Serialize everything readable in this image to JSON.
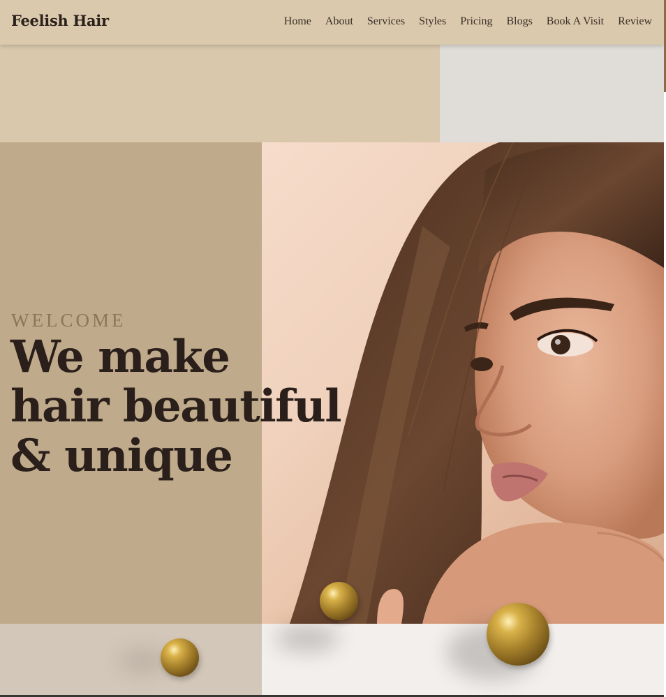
{
  "brand": "Feelish Hair",
  "nav": [
    "Home",
    "About",
    "Services",
    "Styles",
    "Pricing",
    "Blogs",
    "Book A Visit",
    "Review"
  ],
  "hero": {
    "eyebrow": "WELCOME",
    "headline_lines": [
      "We make",
      "hair beautiful",
      "& unique"
    ]
  },
  "colors": {
    "header_bg": "#dac9ad",
    "hero_panel": "#bfab8b",
    "heading": "#2a1f1a",
    "eyebrow": "#8e7556",
    "accent_gold": "#a9832c"
  },
  "decorations": [
    "gold-sphere",
    "gold-sphere",
    "gold-sphere"
  ]
}
